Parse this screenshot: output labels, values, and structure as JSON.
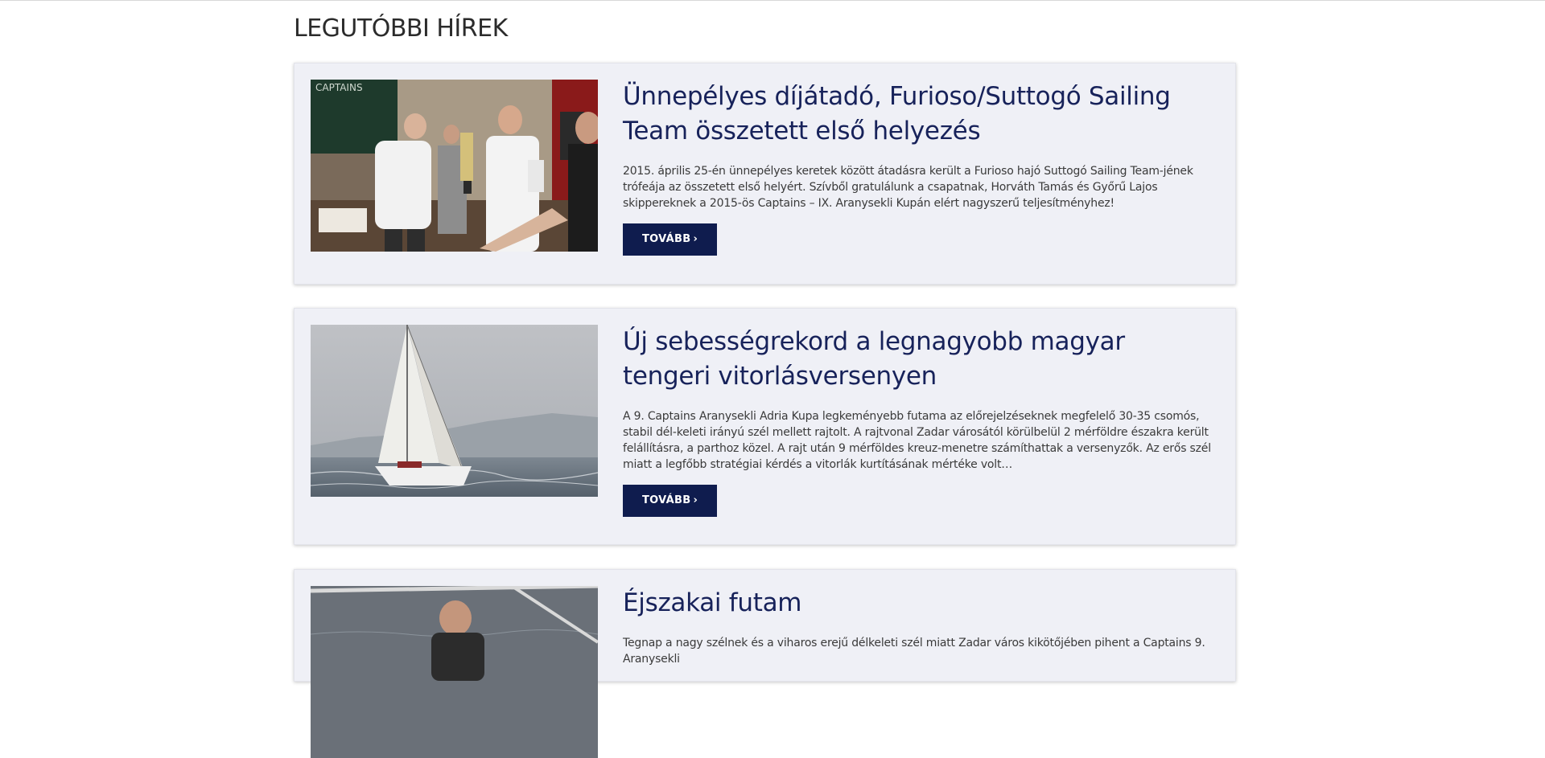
{
  "section": {
    "title": "LEGUTÓBBI HÍREK"
  },
  "articles": [
    {
      "title": "Ünnepélyes díjátadó, Furioso/Suttogó Sailing Team összetett első helyezés",
      "excerpt": "2015. április 25-én ünnepélyes keretek között átadásra került a Furioso hajó Suttogó Sailing Team-jének trófeája az összetett első helyért. Szívből gratulálunk a csapatnak, Horváth Tamás és Győrű Lajos skippereknek a 2015-ös Captains – IX. Aranysekli Kupán elért nagyszerű teljesítményhez!",
      "button_label": "TOVÁBB",
      "button_icon": "chevron-right-icon",
      "image_sign_text": "CAPTAINS"
    },
    {
      "title": "Új sebességrekord a legnagyobb magyar tengeri vitorlásversenyen",
      "excerpt": "A 9. Captains Aranysekli Adria Kupa legkeményebb futama az előrejelzéseknek megfelelő 30-35 csomós, stabil dél-keleti irányú szél mellett rajtolt. A rajtvonal Zadar városától körülbelül 2 mérföldre északra került felállításra, a parthoz közel. A rajt után 9 mérföldes kreuz-menetre számíthattak a versenyzők. Az erős szél miatt a legfőbb stratégiai kérdés a vitorlák kurtításának mértéke volt…",
      "button_label": "TOVÁBB",
      "button_icon": "chevron-right-icon"
    },
    {
      "title": "Éjszakai futam",
      "excerpt": "Tegnap a nagy szélnek és a viharos erejű délkeleti szél miatt Zadar város kikötőjében pihent a Captains 9. Aranysekli",
      "button_label": "TOVÁBB",
      "button_icon": "chevron-right-icon"
    }
  ],
  "colors": {
    "accent": "#0f1c4e",
    "title": "#17225a",
    "card_bg": "#eff0f6"
  }
}
